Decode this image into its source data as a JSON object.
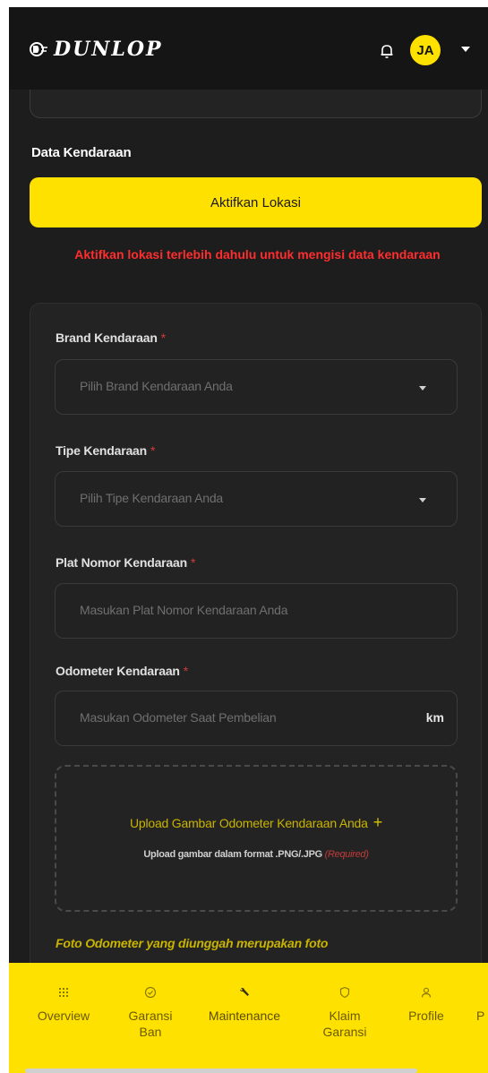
{
  "header": {
    "logo_text": "DUNLOP",
    "avatar_initials": "JA",
    "accent_color": "#ffe100"
  },
  "section": {
    "title": "Data Kendaraan",
    "activate_button": "Aktifkan Lokasi",
    "warning": "Aktifkan lokasi terlebih dahulu untuk mengisi data kendaraan",
    "warning_color": "#ff2d2d"
  },
  "form": {
    "brand": {
      "label": "Brand Kendaraan",
      "required": "*",
      "placeholder": "Pilih Brand Kendaraan Anda"
    },
    "type": {
      "label": "Tipe Kendaraan",
      "required": "*",
      "placeholder": "Pilih Tipe Kendaraan Anda"
    },
    "plate": {
      "label": "Plat Nomor Kendaraan",
      "required": "*",
      "placeholder": "Masukan Plat Nomor Kendaraan Anda"
    },
    "odometer": {
      "label": "Odometer Kendaraan",
      "required": "*",
      "placeholder": "Masukan Odometer Saat Pembelian",
      "unit": "km"
    },
    "upload": {
      "title": "Upload Gambar Odometer Kendaraan Anda",
      "plus": "+",
      "subtitle": "Upload gambar dalam format .PNG/.JPG",
      "required_note": "(Required)"
    },
    "note": "Foto Odometer yang diunggah merupakan foto"
  },
  "bottom_nav": {
    "items": [
      {
        "icon": "grid-icon",
        "label_1": "Overview",
        "label_2": ""
      },
      {
        "icon": "check-circle-icon",
        "label_1": "Garansi",
        "label_2": "Ban"
      },
      {
        "icon": "wrench-icon",
        "label_1": "Maintenance",
        "label_2": ""
      },
      {
        "icon": "shield-icon",
        "label_1": "Klaim",
        "label_2": "Garansi"
      },
      {
        "icon": "user-icon",
        "label_1": "Profile",
        "label_2": ""
      },
      {
        "icon": "",
        "label_1": "P",
        "label_2": ""
      }
    ]
  }
}
